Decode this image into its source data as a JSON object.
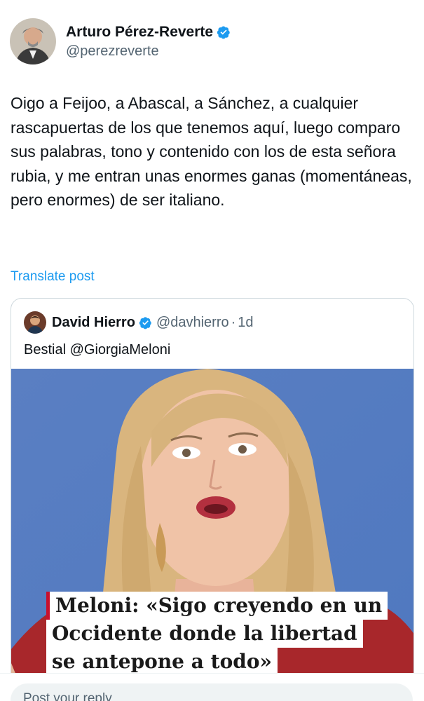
{
  "author": {
    "display_name": "Arturo Pérez-Reverte",
    "handle": "@perezreverte",
    "verified": true
  },
  "post": {
    "text": "Oigo a Feijoo, a Abascal, a Sánchez, a cualquier rascapuertas de los que tenemos aquí, luego comparo sus palabras, tono y contenido con los de esta señora rubia, y me entran unas enormes ganas (momentáneas, pero enormes) de ser italiano.",
    "translate_label": "Translate post"
  },
  "quote": {
    "display_name": "David Hierro",
    "handle": "@davhierro",
    "separator": "·",
    "time": "1d",
    "text": "Bestial @GiorgiaMeloni",
    "media": {
      "caption_lines": [
        "Meloni: «Sigo creyendo en un",
        "Occidente donde la libertad",
        "se antepone a todo»"
      ]
    }
  },
  "reply": {
    "placeholder": "Post your reply"
  },
  "colors": {
    "accent": "#1d9bf0",
    "text": "#0f1419",
    "secondary": "#536471",
    "caption_bar": "#c8102e"
  }
}
